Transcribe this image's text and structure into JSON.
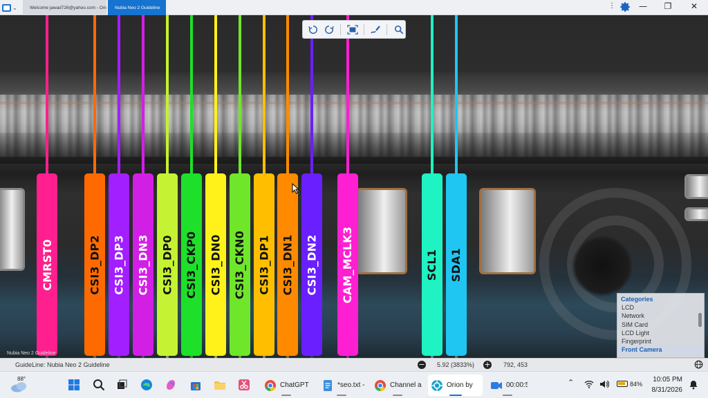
{
  "window": {
    "tabs": [
      {
        "label": "Welcome jawad726@yahoo.com - Orion"
      },
      {
        "label": "Nubia Neo 2 Guideline"
      }
    ],
    "controls": {
      "more": "⋮",
      "minimize": "—",
      "maximize": "❐",
      "close": "✕"
    }
  },
  "probes": [
    {
      "label": "CMRST0",
      "color": "#ff1f8e",
      "text_color": "#ffffff"
    },
    {
      "label": "CSI3_DP2",
      "color": "#ff6a00",
      "text_color": "#111111"
    },
    {
      "label": "CSI3_DP3",
      "color": "#a21fff",
      "text_color": "#ffffff"
    },
    {
      "label": "CSI3_DN3",
      "color": "#d21fe6",
      "text_color": "#ffffff"
    },
    {
      "label": "CSI3_DP0",
      "color": "#c5f233",
      "text_color": "#111111"
    },
    {
      "label": "CSI3_CKP0",
      "color": "#1ee02a",
      "text_color": "#111111"
    },
    {
      "label": "CSI3_DN0",
      "color": "#fff21a",
      "text_color": "#111111"
    },
    {
      "label": "CSI3_CKN0",
      "color": "#6fe62a",
      "text_color": "#111111"
    },
    {
      "label": "CSI3_DP1",
      "color": "#ffbf00",
      "text_color": "#111111"
    },
    {
      "label": "CSI3_DN1",
      "color": "#ff8a00",
      "text_color": "#111111"
    },
    {
      "label": "CSI3_DN2",
      "color": "#6a1fff",
      "text_color": "#ffffff"
    },
    {
      "label": "CAM_MCLK3",
      "color": "#ff1fd2",
      "text_color": "#ffffff"
    },
    {
      "label": "SCL1",
      "color": "#1ff2c3",
      "text_color": "#111111"
    },
    {
      "label": "SDA1",
      "color": "#1fc6f2",
      "text_color": "#111111"
    }
  ],
  "categories": {
    "title": "Categories",
    "items": [
      "LCD",
      "Network",
      "SIM Card",
      "LCD Light",
      "Fingerprint",
      "Front Camera"
    ],
    "selected": "Front Camera"
  },
  "watermark": "Nubia Neo 2 Guideline",
  "status": {
    "guideline": "GuideLine: Nubia Neo 2 Guideline",
    "zoom": "5.92 (3833%)",
    "coords": "792, 453",
    "minus": "−",
    "plus": "+"
  },
  "taskbar": {
    "temperature": "88°",
    "apps": [
      {
        "label": "ChatGPT",
        "icon": "chrome-icon"
      },
      {
        "label": "*seo.txt -",
        "icon": "notepad-icon"
      },
      {
        "label": "Channel a",
        "icon": "chrome-icon"
      },
      {
        "label": "Orion by",
        "icon": "orion-icon"
      },
      {
        "label": "00:00:5",
        "icon": "camera-icon"
      }
    ],
    "battery": "84%",
    "time": "10:05 PM",
    "date": "8/31/2026"
  }
}
